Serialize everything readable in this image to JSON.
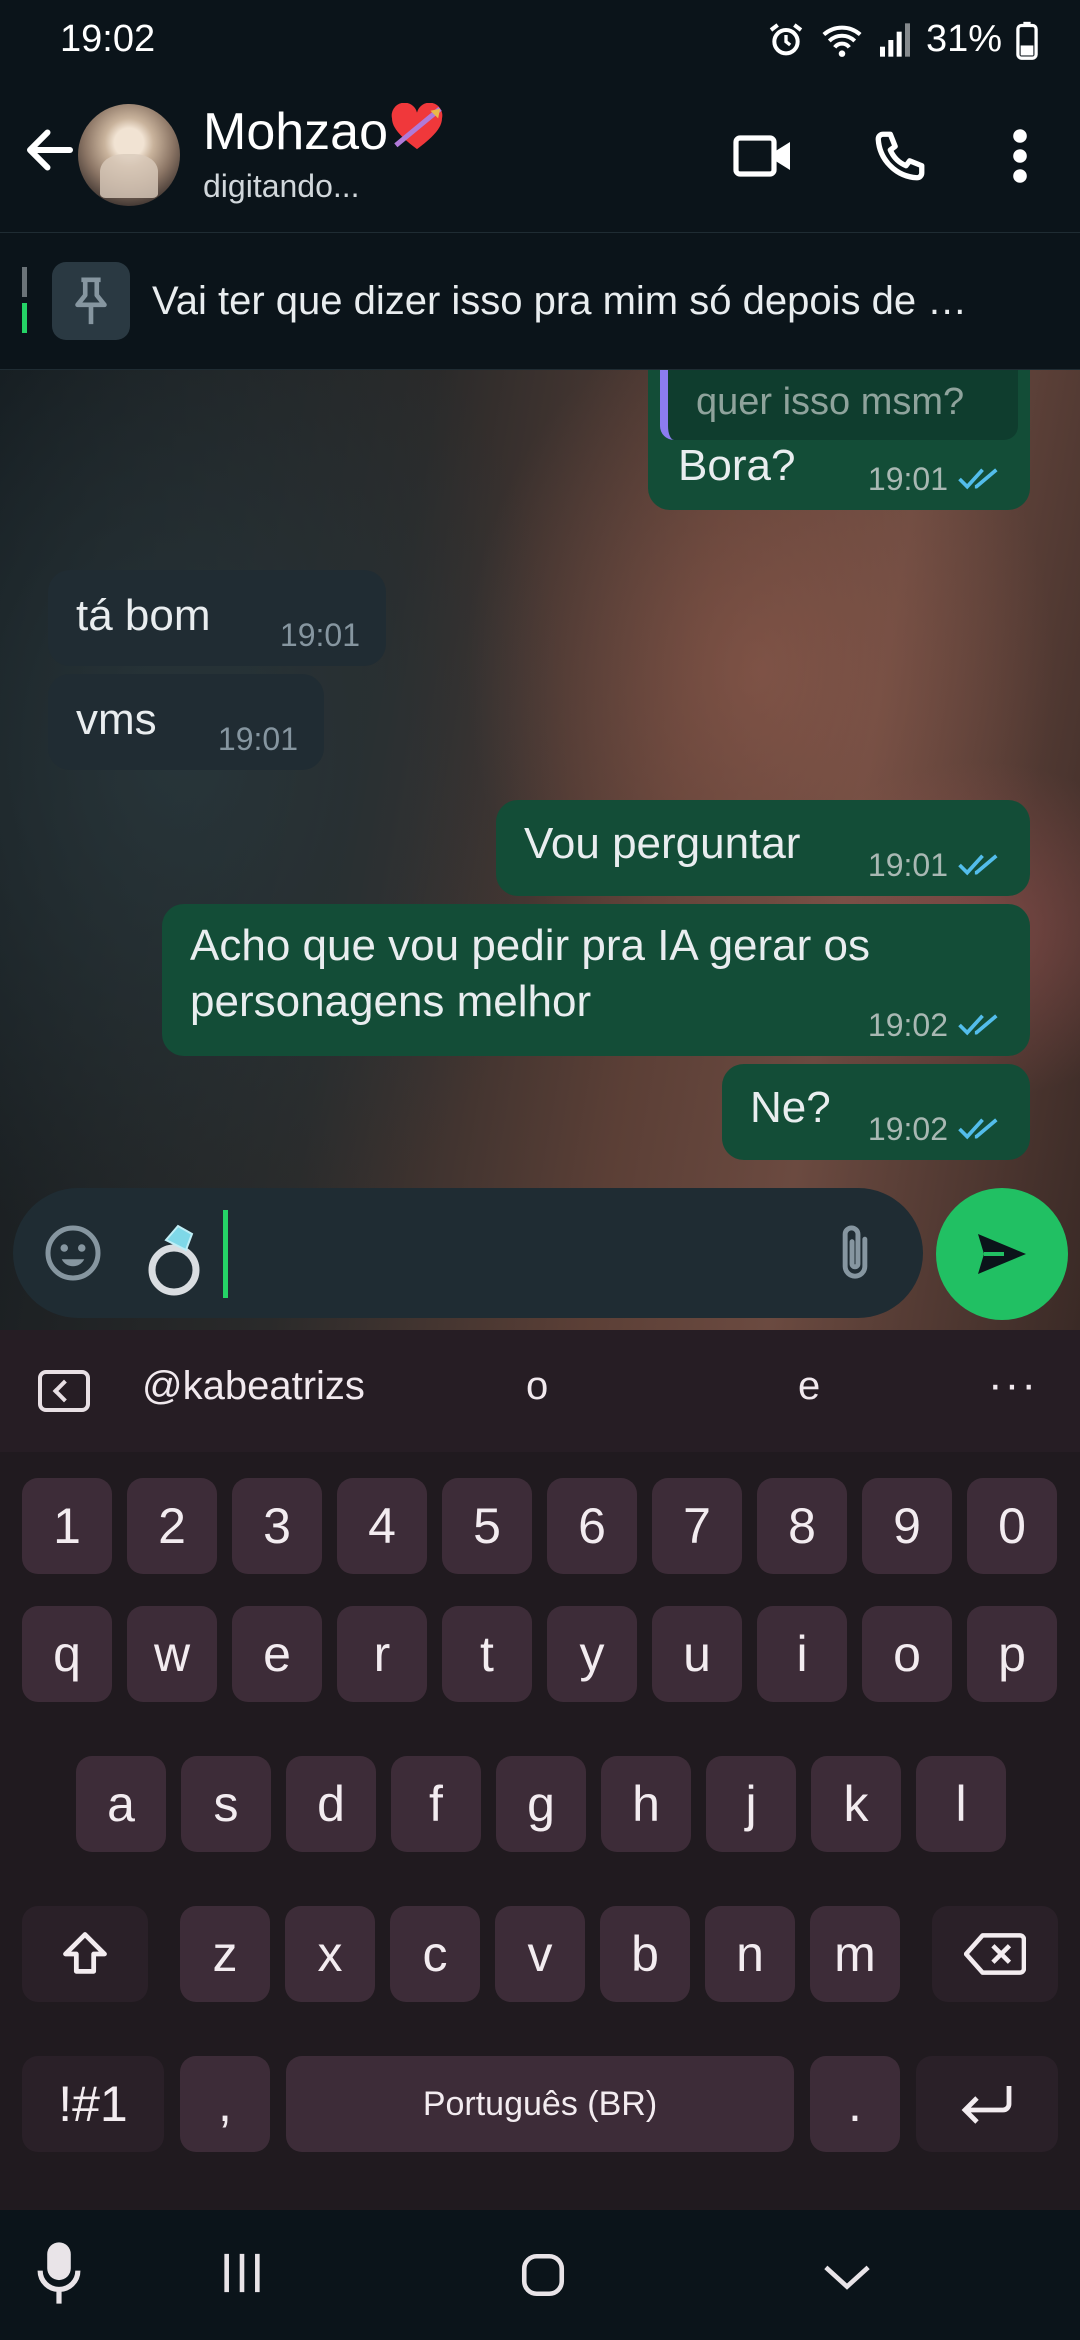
{
  "status_bar": {
    "time": "19:02",
    "battery": "31%",
    "icons": [
      "alarm-icon",
      "wifi-icon",
      "signal-icon",
      "battery-icon"
    ]
  },
  "header": {
    "contact_name": "Mohzao❤️‍🔥",
    "contact_name_text": "Mohzao",
    "status": "digitando...",
    "icons": [
      "back-arrow-icon",
      "video-call-icon",
      "voice-call-icon",
      "more-vert-icon"
    ]
  },
  "pinned": {
    "text": "Vai ter que dizer isso pra mim só depois de …"
  },
  "messages": [
    {
      "id": "m0",
      "direction": "out",
      "quoted": "quer isso msm?",
      "text": "Bora?",
      "time": "19:01",
      "status": "read"
    },
    {
      "id": "m1",
      "direction": "in",
      "text": "tá bom",
      "time": "19:01"
    },
    {
      "id": "m2",
      "direction": "in",
      "text": "vms",
      "time": "19:01"
    },
    {
      "id": "m3",
      "direction": "out",
      "text": "Vou perguntar",
      "time": "19:01",
      "status": "read"
    },
    {
      "id": "m4",
      "direction": "out",
      "text": "Acho que vou pedir pra IA gerar os personagens melhor",
      "time": "19:02",
      "status": "read"
    },
    {
      "id": "m5",
      "direction": "out",
      "text": "Ne?",
      "time": "19:02",
      "status": "read"
    }
  ],
  "composer": {
    "value": "💍",
    "icons": [
      "emoji-icon",
      "attach-icon",
      "send-icon"
    ]
  },
  "keyboard": {
    "suggestions": [
      "@kabeatrizs",
      "o",
      "e"
    ],
    "more": "···",
    "row_numbers": [
      "1",
      "2",
      "3",
      "4",
      "5",
      "6",
      "7",
      "8",
      "9",
      "0"
    ],
    "row1": [
      "q",
      "w",
      "e",
      "r",
      "t",
      "y",
      "u",
      "i",
      "o",
      "p"
    ],
    "row2": [
      "a",
      "s",
      "d",
      "f",
      "g",
      "h",
      "j",
      "k",
      "l"
    ],
    "row3": [
      "z",
      "x",
      "c",
      "v",
      "b",
      "n",
      "m"
    ],
    "symbols_key": "!#1",
    "comma_key": ",",
    "space_label": "Português (BR)",
    "period_key": "."
  },
  "colors": {
    "accent": "#25d366",
    "bubble_out": "#134d37",
    "bubble_in": "#202c33",
    "read_tick": "#53bdeb"
  }
}
